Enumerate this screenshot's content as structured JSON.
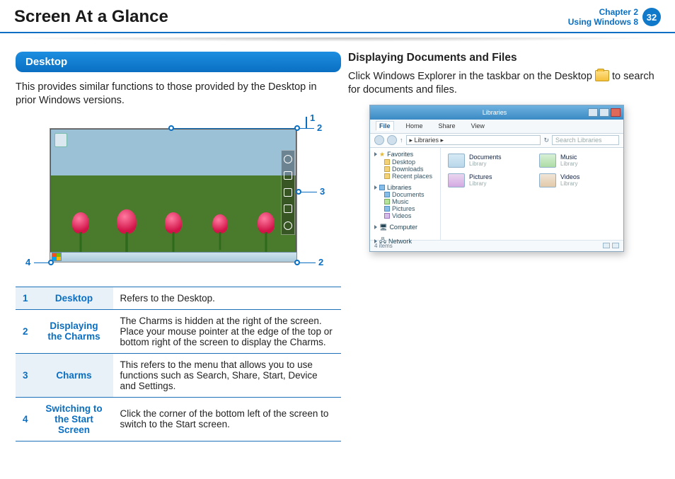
{
  "header": {
    "title": "Screen At a Glance",
    "chapter_line1": "Chapter 2",
    "chapter_line2": "Using Windows 8",
    "page_number": "32"
  },
  "left": {
    "section_label": "Desktop",
    "intro": "This provides similar functions to those provided by the Desktop in prior Windows versions.",
    "callouts": {
      "c1": "1",
      "c2a": "2",
      "c2b": "2",
      "c3": "3",
      "c4": "4"
    },
    "table": [
      {
        "n": "1",
        "term": "Desktop",
        "desc": "Refers to the Desktop."
      },
      {
        "n": "2",
        "term": "Displaying the Charms",
        "desc": "The Charms is hidden at the right of the screen. Place your mouse pointer at the edge of the top or bottom right of the screen to display the Charms."
      },
      {
        "n": "3",
        "term": "Charms",
        "desc": "This refers to the menu that allows you to use functions such as Search, Share, Start, Device and Settings."
      },
      {
        "n": "4",
        "term": "Switching to the Start Screen",
        "desc": "Click the corner of the bottom left of the screen to switch to the Start screen."
      }
    ]
  },
  "right": {
    "heading": "Displaying Documents and Files",
    "para_before": "Click Windows Explorer in the taskbar on the Desktop ",
    "para_after": " to search for documents and files.",
    "explorer": {
      "title": "Libraries",
      "tabs": {
        "file": "File",
        "home": "Home",
        "share": "Share",
        "view": "View"
      },
      "path": "▸ Libraries ▸",
      "refresh_hint": "↻",
      "search_placeholder": "Search Libraries",
      "nav": {
        "favorites": "Favorites",
        "fav_items": {
          "desktop": "Desktop",
          "downloads": "Downloads",
          "recent": "Recent places"
        },
        "libraries": "Libraries",
        "lib_items": {
          "documents": "Documents",
          "music": "Music",
          "pictures": "Pictures",
          "videos": "Videos"
        },
        "computer": "Computer",
        "network": "Network"
      },
      "tiles": {
        "documents": "Documents",
        "music": "Music",
        "pictures": "Pictures",
        "videos": "Videos",
        "sub": "Library"
      },
      "status": "4 items"
    }
  }
}
